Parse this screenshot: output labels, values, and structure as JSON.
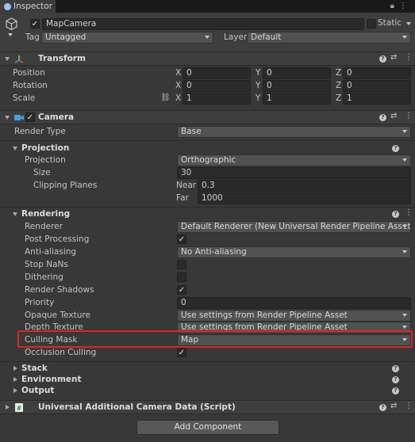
{
  "tab": {
    "label": "Inspector"
  },
  "gameobject": {
    "name": "MapCamera",
    "static_label": "Static",
    "tag_label": "Tag",
    "tag_value": "Untagged",
    "layer_label": "Layer",
    "layer_value": "Default"
  },
  "transform": {
    "title": "Transform",
    "rows": [
      {
        "label": "Position",
        "x": "0",
        "y": "0",
        "z": "0"
      },
      {
        "label": "Rotation",
        "x": "0",
        "y": "0",
        "z": "0"
      },
      {
        "label": "Scale",
        "x": "1",
        "y": "1",
        "z": "1"
      }
    ],
    "axis_x": "X",
    "axis_y": "Y",
    "axis_z": "Z"
  },
  "camera": {
    "title": "Camera",
    "render_type_label": "Render Type",
    "render_type_value": "Base",
    "projection_header": "Projection",
    "projection_label": "Projection",
    "projection_value": "Orthographic",
    "size_label": "Size",
    "size_value": "30",
    "clipping_label": "Clipping Planes",
    "near_label": "Near",
    "near_value": "0.3",
    "far_label": "Far",
    "far_value": "1000",
    "rendering_header": "Rendering",
    "renderer_label": "Renderer",
    "renderer_value": "Default Renderer (New Universal Render Pipeline Asset_Rend",
    "post_processing_label": "Post Processing",
    "anti_aliasing_label": "Anti-aliasing",
    "anti_aliasing_value": "No Anti-aliasing",
    "stop_nans_label": "Stop NaNs",
    "dithering_label": "Dithering",
    "render_shadows_label": "Render Shadows",
    "priority_label": "Priority",
    "priority_value": "0",
    "opaque_texture_label": "Opaque Texture",
    "opaque_texture_value": "Use settings from Render Pipeline Asset",
    "depth_texture_label": "Depth Texture",
    "depth_texture_value": "Use settings from Render Pipeline Asset",
    "culling_mask_label": "Culling Mask",
    "culling_mask_value": "Map",
    "occlusion_culling_label": "Occlusion Culling",
    "stack_header": "Stack",
    "environment_header": "Environment",
    "output_header": "Output",
    "checks": {
      "post_processing": true,
      "stop_nans": false,
      "dithering": false,
      "render_shadows": true,
      "occlusion_culling": true
    }
  },
  "additional_camera_data": {
    "title": "Universal Additional Camera Data (Script)"
  },
  "add_component_label": "Add Component",
  "colors": {
    "highlight": "#d4292a",
    "background": "#383838",
    "header": "#3e3e3e"
  }
}
